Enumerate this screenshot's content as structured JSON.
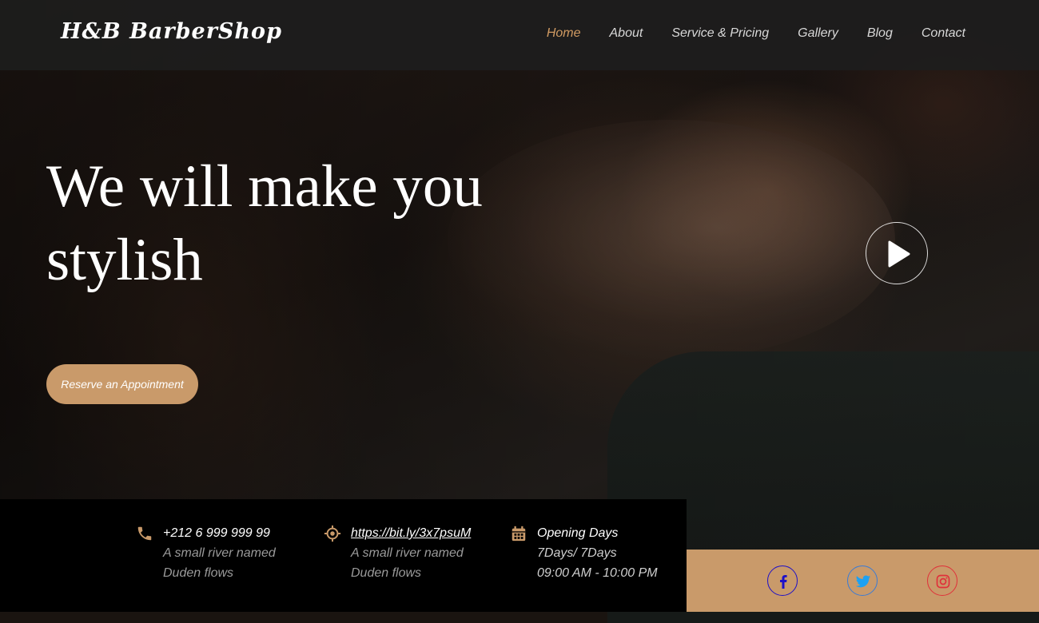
{
  "brand": {
    "name": "H&B BarberShop"
  },
  "nav": {
    "items": [
      {
        "label": "Home",
        "active": true
      },
      {
        "label": "About"
      },
      {
        "label": "Service & Pricing"
      },
      {
        "label": "Gallery"
      },
      {
        "label": "Blog"
      },
      {
        "label": "Contact"
      }
    ]
  },
  "hero": {
    "headline": "We will make you stylish",
    "cta_label": "Reserve an Appointment",
    "play_icon": "play-icon"
  },
  "info": {
    "phone": {
      "icon": "phone-icon",
      "title": "+212 6 999 999 99",
      "line2": "A small river named",
      "line3": "Duden flows"
    },
    "location": {
      "icon": "location-icon",
      "title": "https://bit.ly/3x7psuM",
      "line2": "A small river named",
      "line3": "Duden flows"
    },
    "hours": {
      "icon": "calendar-icon",
      "title": "Opening Days",
      "line2": "7Days/ 7Days",
      "line3": "09:00 AM - 10:00 PM"
    }
  },
  "social": [
    {
      "icon": "facebook-icon",
      "color": "#1e10c8"
    },
    {
      "icon": "twitter-icon",
      "color": "#1da1f2"
    },
    {
      "icon": "instagram-icon",
      "color": "#e0303a"
    }
  ],
  "colors": {
    "accent": "#c99a6a",
    "nav_active": "#d19b62",
    "infobar_bg": "#000000"
  }
}
